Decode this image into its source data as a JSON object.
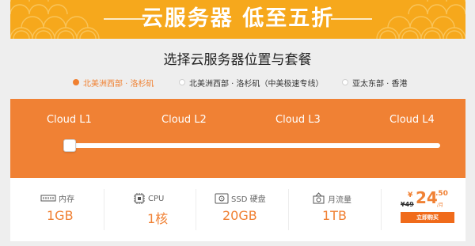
{
  "banner": {
    "title": "云服务器  低至五折"
  },
  "heading": "选择云服务器位置与套餐",
  "regions": [
    {
      "label": "北美洲西部 · 洛杉矶",
      "selected": true
    },
    {
      "label": "北美洲西部 · 洛杉矶（中美极速专线）",
      "selected": false
    },
    {
      "label": "亚太东部 · 香港",
      "selected": false
    }
  ],
  "plans": [
    {
      "label": "Cloud L1"
    },
    {
      "label": "Cloud L2"
    },
    {
      "label": "Cloud L3"
    },
    {
      "label": "Cloud L4"
    }
  ],
  "slider": {
    "selected_index": 0,
    "count": 4
  },
  "specs": [
    {
      "icon": "memory-icon",
      "title": "内存",
      "value": "1GB"
    },
    {
      "icon": "cpu-icon",
      "title": "CPU",
      "value": "1核"
    },
    {
      "icon": "ssd-icon",
      "title": "SSD 硬盘",
      "value": "20GB"
    },
    {
      "icon": "traffic-icon",
      "title": "月流量",
      "value": "1TB"
    }
  ],
  "price": {
    "old": "¥49",
    "currency": "¥",
    "integer": "24",
    "decimal": ".50",
    "unit": "/月",
    "buy_label": "立即购买"
  },
  "colors": {
    "accent": "#f08134",
    "banner": "#f6a81c",
    "button": "#f06b1b"
  }
}
